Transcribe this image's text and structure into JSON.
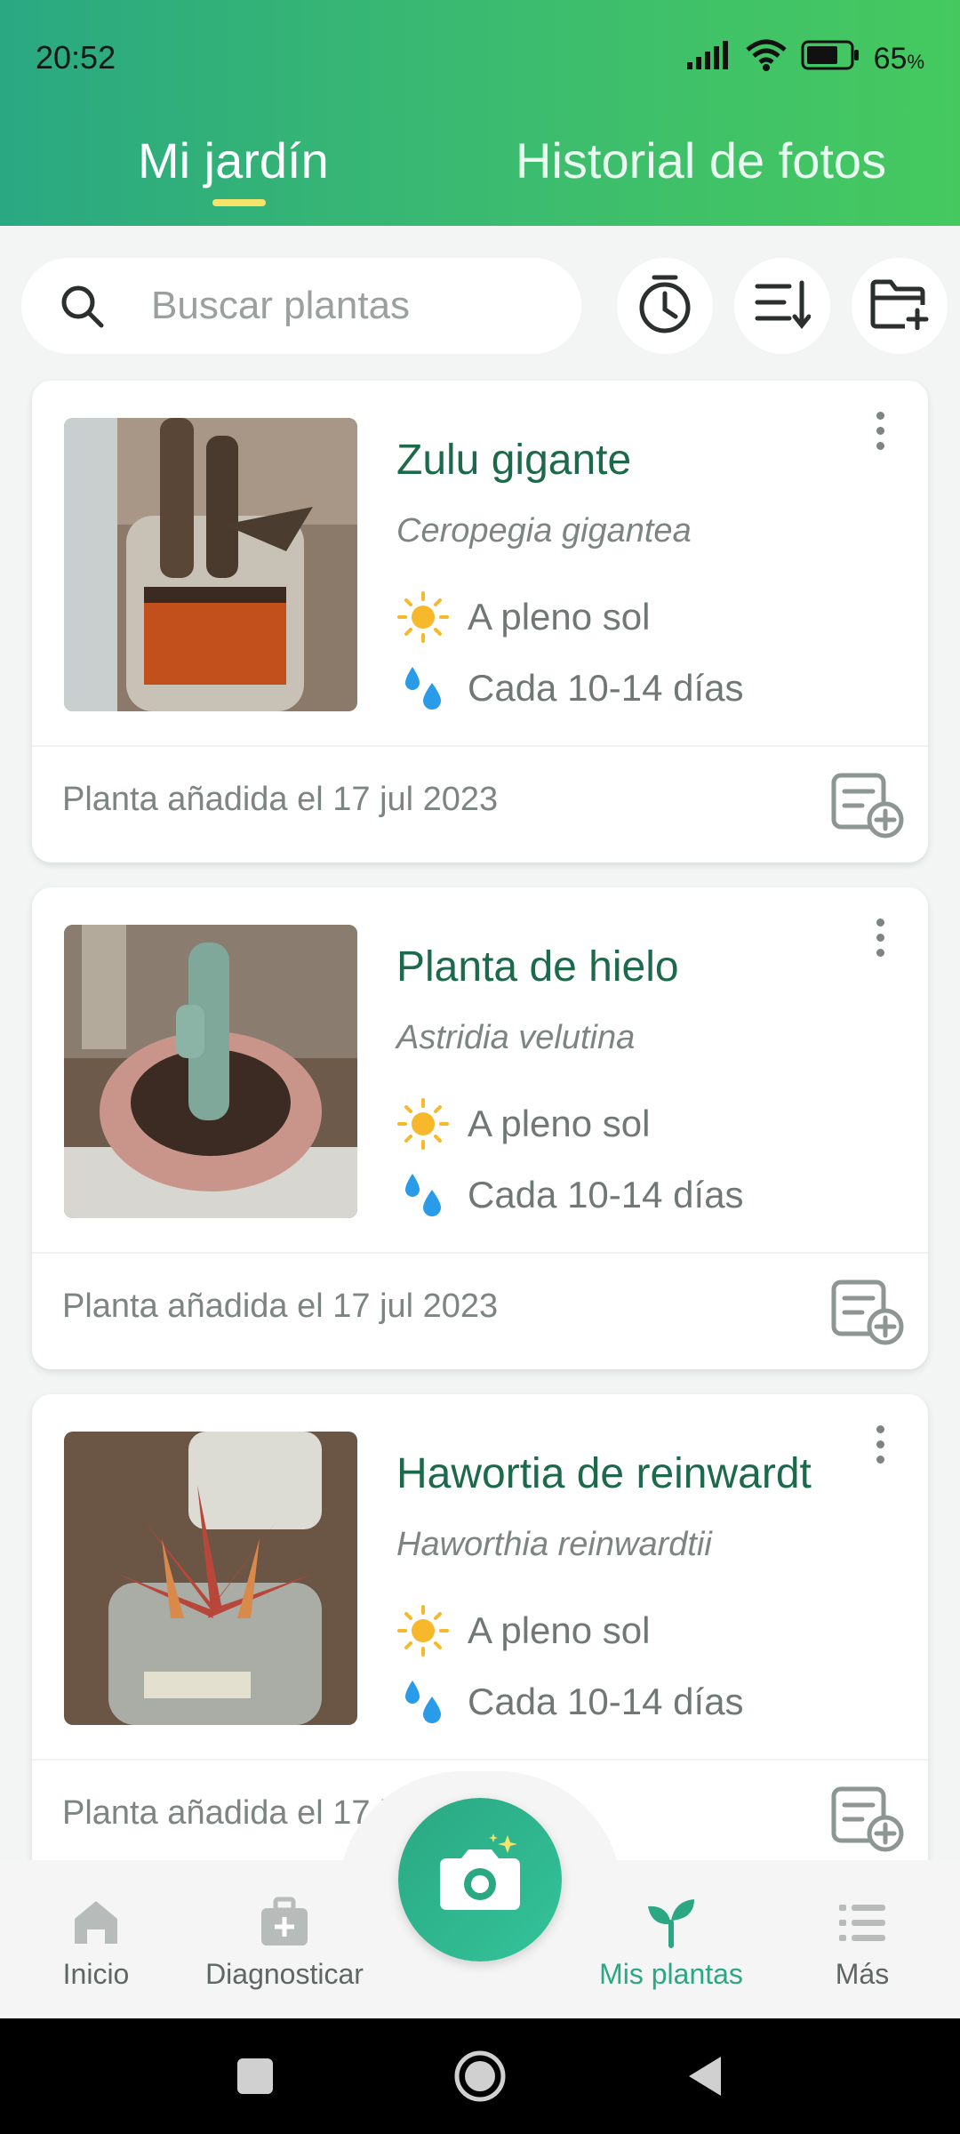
{
  "status_bar": {
    "time": "20:52",
    "battery": "65",
    "battery_unit": "%"
  },
  "tabs": [
    {
      "label": "Mi jardín",
      "active": true
    },
    {
      "label": "Historial de fotos",
      "active": false
    }
  ],
  "search": {
    "placeholder": "Buscar plantas"
  },
  "toolbar_icons": [
    "timer-icon",
    "sort-icon",
    "add-folder-icon"
  ],
  "plants": [
    {
      "name": "Zulu gigante",
      "scientific": "Ceropegia gigantea",
      "light": "A pleno sol",
      "water": "Cada 10-14 días",
      "added": "Planta añadida el 17 jul 2023"
    },
    {
      "name": "Planta de hielo",
      "scientific": "Astridia velutina",
      "light": "A pleno sol",
      "water": "Cada 10-14 días",
      "added": "Planta añadida el 17 jul 2023"
    },
    {
      "name": "Hawortia de reinwardt",
      "scientific": "Haworthia reinwardtii",
      "light": "A pleno sol",
      "water": "Cada 10-14 días",
      "added": "Planta añadida el 17 ju"
    }
  ],
  "bottom_nav": {
    "items": [
      {
        "label": "Inicio",
        "icon": "home-icon"
      },
      {
        "label": "Diagnosticar",
        "icon": "medkit-icon"
      },
      {
        "label": "Mis plantas",
        "icon": "sprout-icon",
        "active": true
      },
      {
        "label": "Más",
        "icon": "list-icon"
      }
    ],
    "fab_icon": "camera-icon"
  },
  "colors": {
    "accent": "#2ba882",
    "header_start": "#2aa882",
    "header_end": "#45c95f",
    "plant_name": "#1c6a4b"
  }
}
